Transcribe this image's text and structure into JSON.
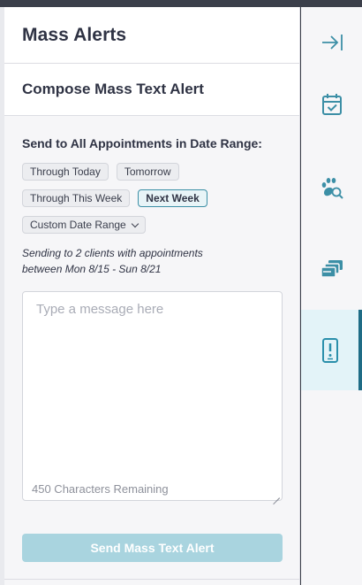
{
  "panel": {
    "title": "Mass Alerts",
    "section_title": "Compose Mass Text Alert"
  },
  "date_range": {
    "label": "Send to All Appointments in Date Range:",
    "options": [
      {
        "label": "Through Today",
        "active": false
      },
      {
        "label": "Tomorrow",
        "active": false
      },
      {
        "label": "Through This Week",
        "active": false
      },
      {
        "label": "Next Week",
        "active": true
      },
      {
        "label": "Custom Date Range",
        "active": false,
        "dropdown": true
      }
    ]
  },
  "summary": {
    "line1": "Sending to 2 clients with appointments",
    "line2": "between Mon 8/15 - Sun 8/21"
  },
  "message": {
    "placeholder": "Type a message here",
    "value": "",
    "chars_remaining": "450 Characters Remaining"
  },
  "send_button": {
    "label": "Send Mass Text Alert",
    "enabled": false
  },
  "rail": {
    "items": [
      {
        "icon": "collapse-panel-icon",
        "active": false
      },
      {
        "icon": "calendar-check-icon",
        "active": false
      },
      {
        "icon": "paw-search-icon",
        "active": false
      },
      {
        "icon": "cards-icon",
        "active": false
      },
      {
        "icon": "phone-alert-icon",
        "active": true
      }
    ]
  },
  "colors": {
    "accent": "#1f6c86",
    "active_chip_border": "#3c8fa6",
    "disabled_button": "#a9d4df",
    "icon": "#3c8fa6",
    "active_icon": "#2a8fab"
  }
}
